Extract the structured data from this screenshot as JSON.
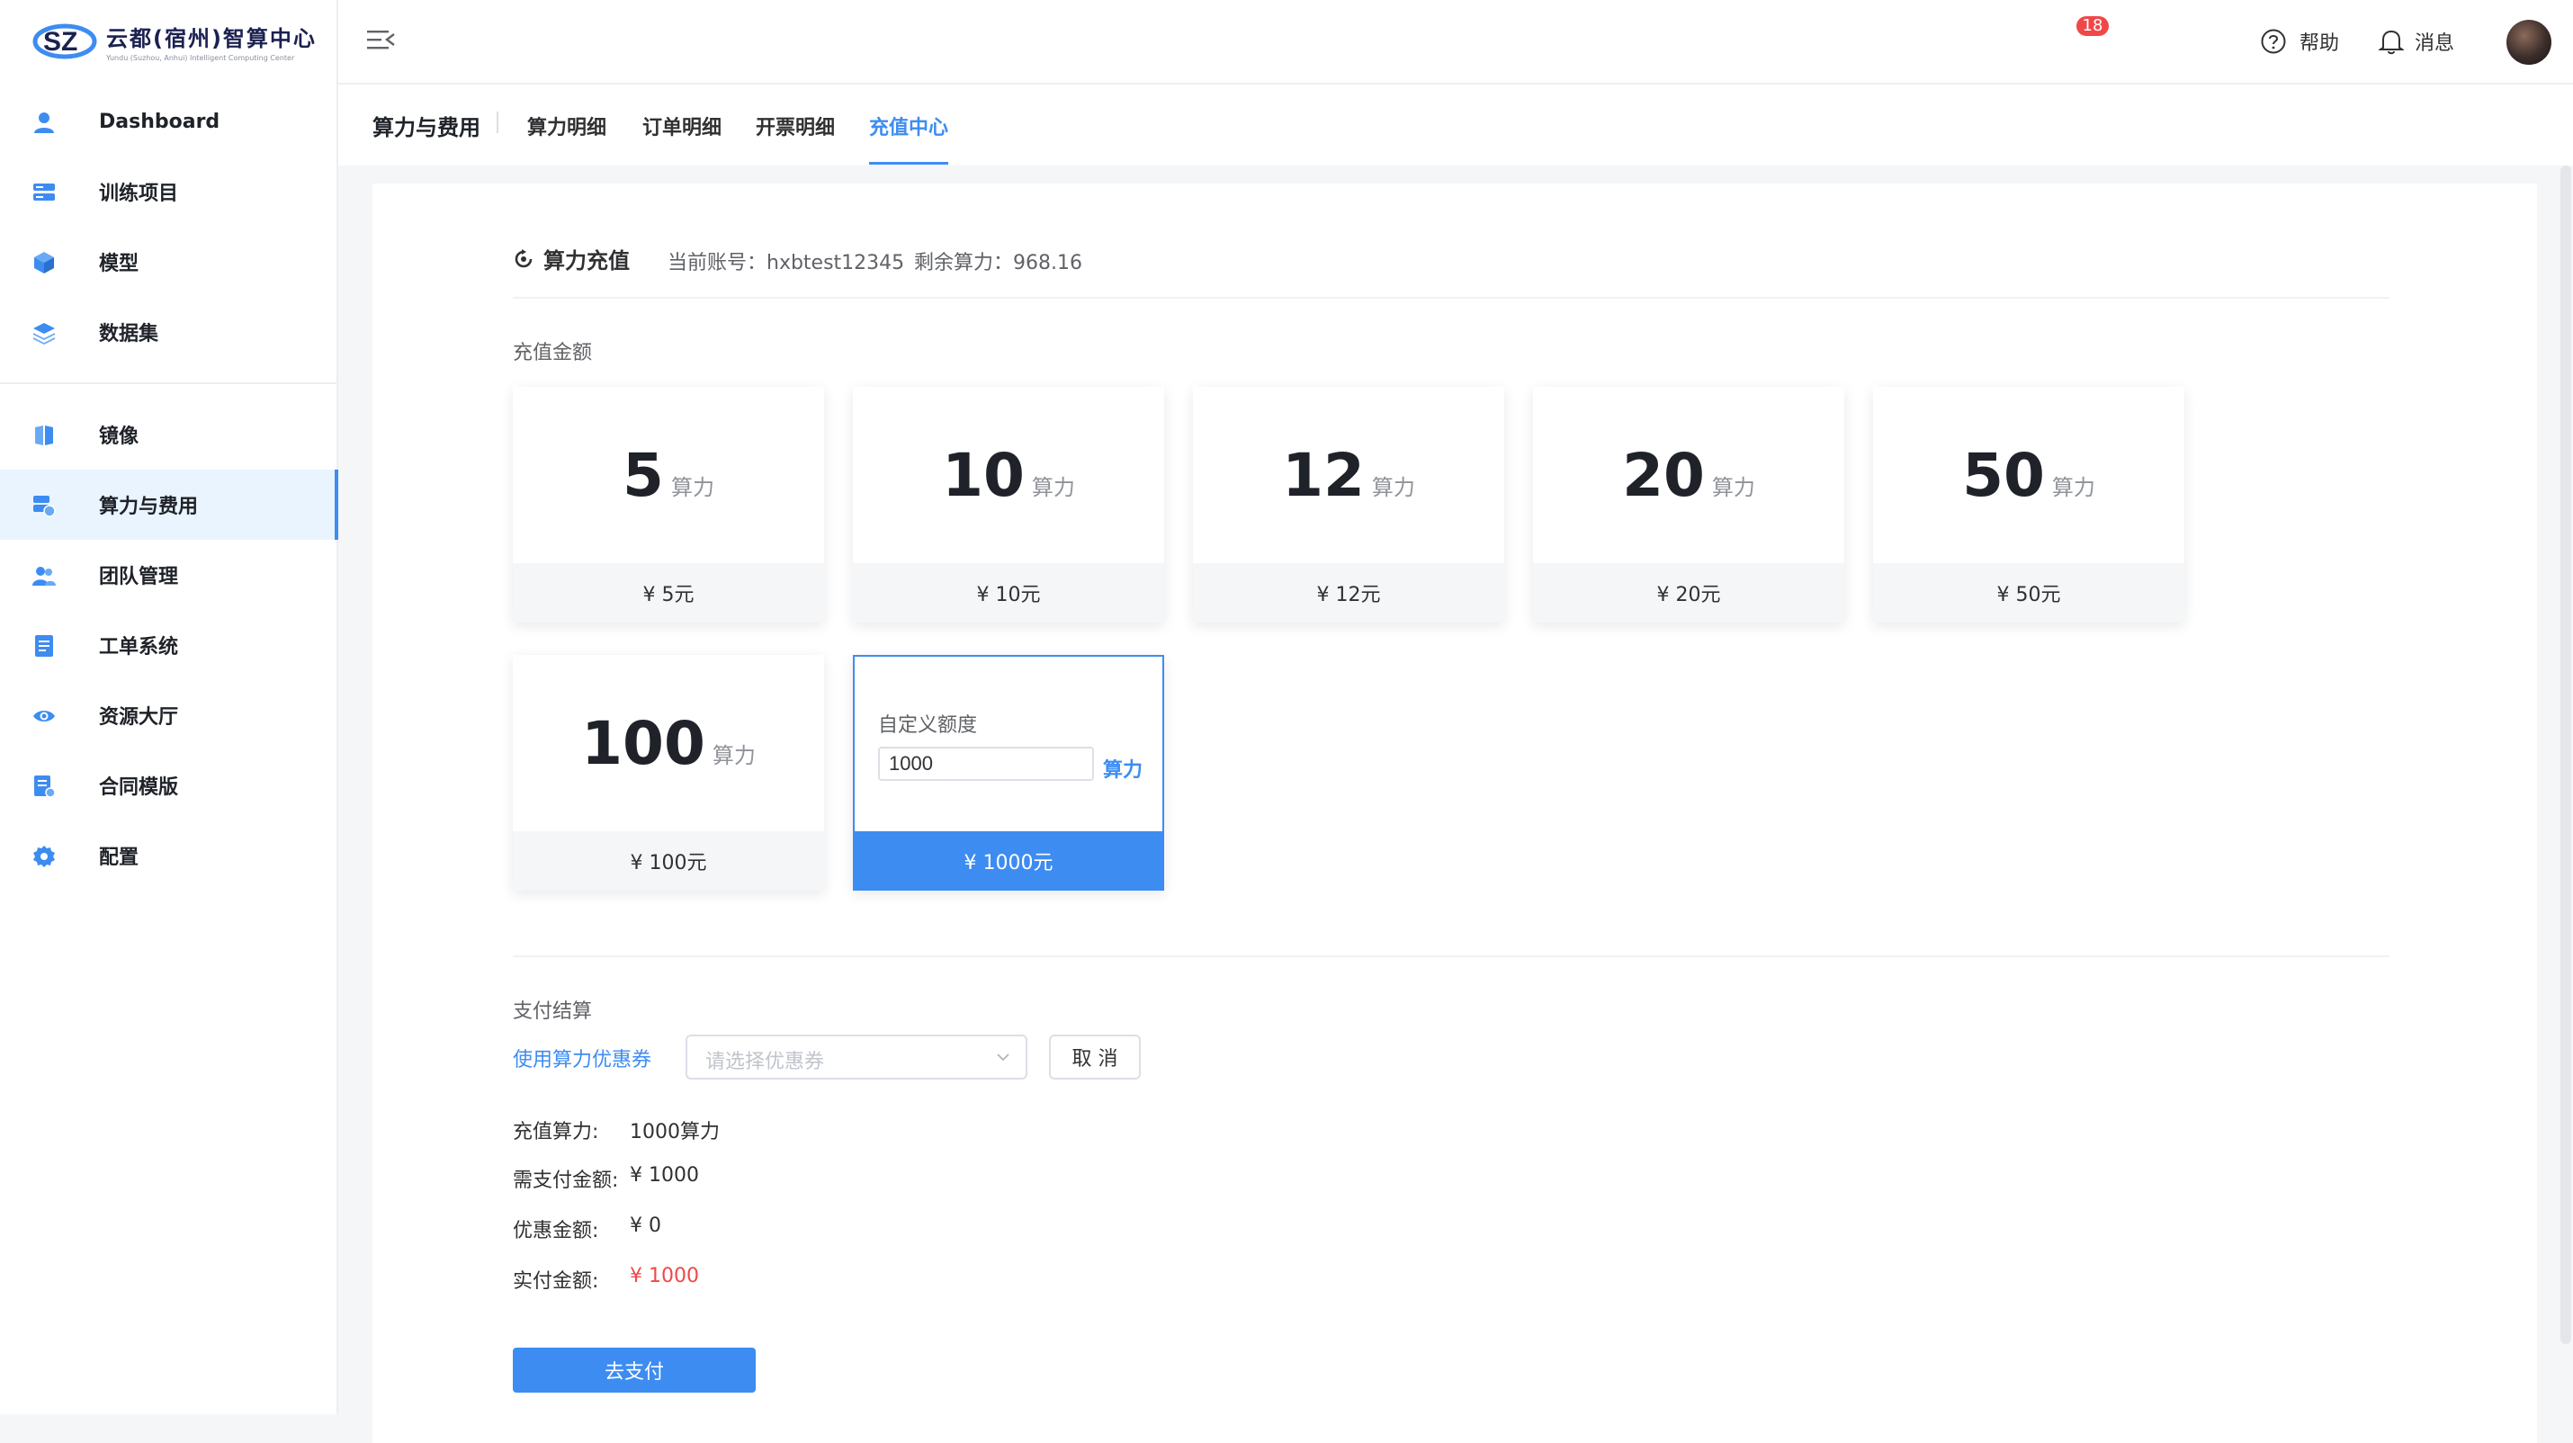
{
  "brand": {
    "title": "云都(宿州)智算中心",
    "subtitle": "Yundu (Suzhou, Anhui) Intelligent Computing Center",
    "colors": {
      "primary": "#3d8cf1",
      "danger": "#f04848",
      "dark": "#1b2150"
    }
  },
  "sidebar": {
    "items": [
      {
        "label": "Dashboard",
        "icon": "user-icon"
      },
      {
        "label": "训练项目",
        "icon": "server-icon"
      },
      {
        "label": "模型",
        "icon": "cube-icon"
      },
      {
        "label": "数据集",
        "icon": "layers-icon"
      },
      {
        "label": "镜像",
        "icon": "mirror-icon"
      },
      {
        "label": "算力与费用",
        "icon": "billing-icon",
        "active": true
      },
      {
        "label": "团队管理",
        "icon": "team-icon"
      },
      {
        "label": "工单系统",
        "icon": "ticket-icon"
      },
      {
        "label": "资源大厅",
        "icon": "eye-icon"
      },
      {
        "label": "合同模版",
        "icon": "contract-icon"
      },
      {
        "label": "配置",
        "icon": "gear-icon"
      }
    ]
  },
  "header": {
    "help_label": "帮助",
    "message_label": "消息",
    "message_count": "18"
  },
  "tabs": {
    "title": "算力与费用",
    "items": [
      "算力明细",
      "订单明细",
      "开票明细",
      "充值中心"
    ],
    "active": "充值中心"
  },
  "recharge": {
    "title": "算力充值",
    "account": "当前账号：hxbtest12345",
    "remaining": "剩余算力：968.16",
    "amount_label": "充值金额",
    "unit": "算力",
    "packages": [
      {
        "amount": "5",
        "price": "¥ 5元"
      },
      {
        "amount": "10",
        "price": "¥ 10元"
      },
      {
        "amount": "12",
        "price": "¥ 12元"
      },
      {
        "amount": "20",
        "price": "¥ 20元"
      },
      {
        "amount": "50",
        "price": "¥ 50元"
      },
      {
        "amount": "100",
        "price": "¥ 100元"
      }
    ],
    "custom": {
      "label": "自定义额度",
      "value": "1000",
      "unit": "算力",
      "price": "¥ 1000元"
    }
  },
  "payment": {
    "section_label": "支付结算",
    "coupon_link": "使用算力优惠券",
    "coupon_placeholder": "请选择优惠券",
    "cancel_label": "取 消",
    "summary": [
      {
        "label": "充值算力:",
        "value": "1000算力"
      },
      {
        "label": "需支付金额:",
        "value": "¥ 1000"
      },
      {
        "label": "优惠金额:",
        "value": "¥ 0"
      },
      {
        "label": "实付金额:",
        "value": "¥ 1000"
      }
    ],
    "pay_label": "去支付"
  }
}
